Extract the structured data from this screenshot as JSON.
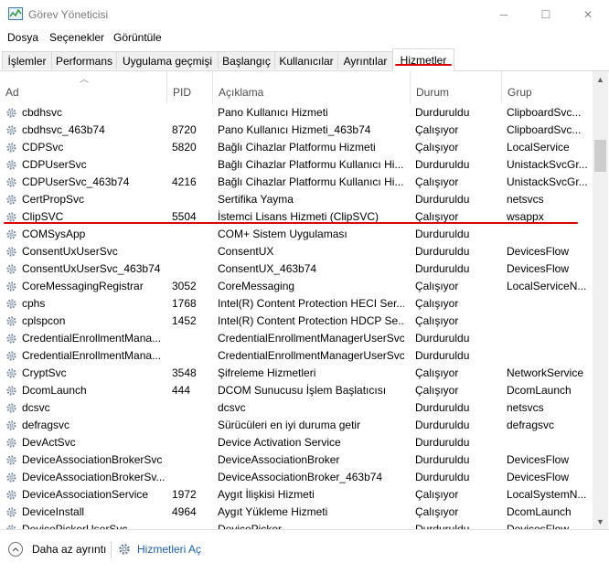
{
  "window": {
    "title": "Görev Yöneticisi"
  },
  "window_controls": {
    "minimize": "─",
    "maximize": "☐",
    "close": "✕"
  },
  "menu": {
    "file": "Dosya",
    "options": "Seçenekler",
    "view": "Görüntüle"
  },
  "tabs": [
    "İşlemler",
    "Performans",
    "Uygulama geçmişi",
    "Başlangıç",
    "Kullanıcılar",
    "Ayrıntılar",
    "Hizmetler"
  ],
  "active_tab": "Hizmetler",
  "columns": {
    "name": "Ad",
    "pid": "PID",
    "desc": "Açıklama",
    "status": "Durum",
    "group": "Grup"
  },
  "rows": [
    {
      "name": "cbdhsvc",
      "pid": "",
      "desc": "Pano Kullanıcı Hizmeti",
      "status": "Durduruldu",
      "group": "ClipboardSvc..."
    },
    {
      "name": "cbdhsvc_463b74",
      "pid": "8720",
      "desc": "Pano Kullanıcı Hizmeti_463b74",
      "status": "Çalışıyor",
      "group": "ClipboardSvc..."
    },
    {
      "name": "CDPSvc",
      "pid": "5820",
      "desc": "Bağlı Cihazlar Platformu Hizmeti",
      "status": "Çalışıyor",
      "group": "LocalService"
    },
    {
      "name": "CDPUserSvc",
      "pid": "",
      "desc": "Bağlı Cihazlar Platformu Kullanıcı Hi...",
      "status": "Durduruldu",
      "group": "UnistackSvcGr..."
    },
    {
      "name": "CDPUserSvc_463b74",
      "pid": "4216",
      "desc": "Bağlı Cihazlar Platformu Kullanıcı Hi...",
      "status": "Çalışıyor",
      "group": "UnistackSvcGr..."
    },
    {
      "name": "CertPropSvc",
      "pid": "",
      "desc": "Sertifika Yayma",
      "status": "Durduruldu",
      "group": "netsvcs"
    },
    {
      "name": "ClipSVC",
      "pid": "5504",
      "desc": "İstemci Lisans Hizmeti (ClipSVC)",
      "status": "Çalışıyor",
      "group": "wsappx"
    },
    {
      "name": "COMSysApp",
      "pid": "",
      "desc": "COM+ Sistem Uygulaması",
      "status": "Durduruldu",
      "group": ""
    },
    {
      "name": "ConsentUxUserSvc",
      "pid": "",
      "desc": "ConsentUX",
      "status": "Durduruldu",
      "group": "DevicesFlow"
    },
    {
      "name": "ConsentUxUserSvc_463b74",
      "pid": "",
      "desc": "ConsentUX_463b74",
      "status": "Durduruldu",
      "group": "DevicesFlow"
    },
    {
      "name": "CoreMessagingRegistrar",
      "pid": "3052",
      "desc": "CoreMessaging",
      "status": "Çalışıyor",
      "group": "LocalServiceN..."
    },
    {
      "name": "cphs",
      "pid": "1768",
      "desc": "Intel(R) Content Protection HECI Ser...",
      "status": "Çalışıyor",
      "group": ""
    },
    {
      "name": "cplspcon",
      "pid": "1452",
      "desc": "Intel(R) Content Protection HDCP Se...",
      "status": "Çalışıyor",
      "group": ""
    },
    {
      "name": "CredentialEnrollmentMana...",
      "pid": "",
      "desc": "CredentialEnrollmentManagerUserSvc",
      "status": "Durduruldu",
      "group": ""
    },
    {
      "name": "CredentialEnrollmentMana...",
      "pid": "",
      "desc": "CredentialEnrollmentManagerUserSvc...",
      "status": "Durduruldu",
      "group": ""
    },
    {
      "name": "CryptSvc",
      "pid": "3548",
      "desc": "Şifreleme Hizmetleri",
      "status": "Çalışıyor",
      "group": "NetworkService"
    },
    {
      "name": "DcomLaunch",
      "pid": "444",
      "desc": "DCOM Sunucusu İşlem Başlatıcısı",
      "status": "Çalışıyor",
      "group": "DcomLaunch"
    },
    {
      "name": "dcsvc",
      "pid": "",
      "desc": "dcsvc",
      "status": "Durduruldu",
      "group": "netsvcs"
    },
    {
      "name": "defragsvc",
      "pid": "",
      "desc": "Sürücüleri en iyi duruma getir",
      "status": "Durduruldu",
      "group": "defragsvc"
    },
    {
      "name": "DevActSvc",
      "pid": "",
      "desc": "Device Activation Service",
      "status": "Durduruldu",
      "group": ""
    },
    {
      "name": "DeviceAssociationBrokerSvc",
      "pid": "",
      "desc": "DeviceAssociationBroker",
      "status": "Durduruldu",
      "group": "DevicesFlow"
    },
    {
      "name": "DeviceAssociationBrokerSv...",
      "pid": "",
      "desc": "DeviceAssociationBroker_463b74",
      "status": "Durduruldu",
      "group": "DevicesFlow"
    },
    {
      "name": "DeviceAssociationService",
      "pid": "1972",
      "desc": "Aygıt İlişkisi Hizmeti",
      "status": "Çalışıyor",
      "group": "LocalSystemN..."
    },
    {
      "name": "DeviceInstall",
      "pid": "4964",
      "desc": "Aygıt Yükleme Hizmeti",
      "status": "Çalışıyor",
      "group": "DcomLaunch"
    },
    {
      "name": "DevicePickerUserSvc",
      "pid": "",
      "desc": "DevicePicker",
      "status": "Durduruldu",
      "group": "DevicesFlow"
    }
  ],
  "footer": {
    "less_details": "Daha az ayrıntı",
    "open_services": "Hizmetleri Aç"
  }
}
